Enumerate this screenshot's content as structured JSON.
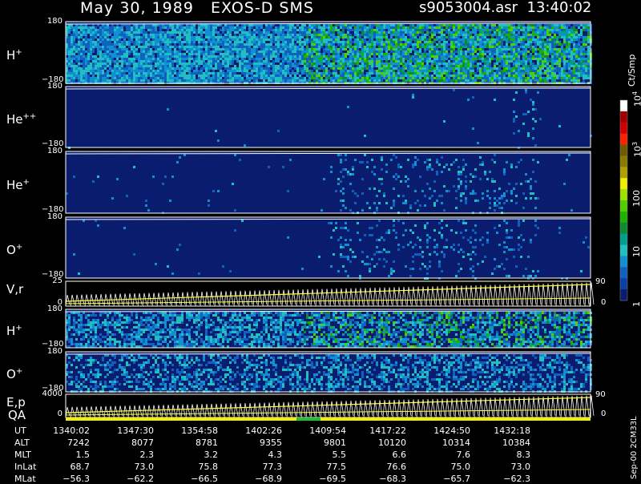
{
  "header": {
    "title": "May 30, 1989   EXOS-D SMS",
    "file_time": "s9053004.asr  13:40:02"
  },
  "colors": {
    "background": "#000000",
    "spectrogram_base": "#0a1c6e",
    "line_yellow": "#ffff40",
    "quality_yellow": "#f0f000",
    "quality_green": "#20c030"
  },
  "panels": [
    {
      "id": "h1",
      "label": "H",
      "sup": "+",
      "tick_top": "180",
      "tick_bottom": "−180"
    },
    {
      "id": "hepp",
      "label": "He",
      "sup": "++",
      "tick_top": "180",
      "tick_bottom": "−180"
    },
    {
      "id": "hep",
      "label": "He",
      "sup": "+",
      "tick_top": "180",
      "tick_bottom": "−180"
    },
    {
      "id": "op",
      "label": "O",
      "sup": "+",
      "tick_top": "180",
      "tick_bottom": "−180"
    },
    {
      "id": "vr",
      "label": "V,r",
      "sup": "",
      "tick_top": "25",
      "tick_bottom": "0",
      "right_top": "90",
      "right_bottom": "0"
    },
    {
      "id": "h2",
      "label": "H",
      "sup": "+",
      "tick_top": "180",
      "tick_bottom": "−180"
    },
    {
      "id": "o2",
      "label": "O",
      "sup": "+",
      "tick_top": "180",
      "tick_bottom": "−180"
    },
    {
      "id": "ep",
      "label": "E,p",
      "sup": "",
      "tick_top": "4000",
      "tick_bottom": "0",
      "right_top": "90",
      "right_bottom": "0"
    }
  ],
  "qa_label": "QA",
  "colorbar": {
    "unit": "Ct/Smp",
    "labels": [
      {
        "text": "10",
        "sup": "4",
        "value": 10000
      },
      {
        "text": "10",
        "sup": "3",
        "value": 1000
      },
      {
        "text": "100",
        "sup": "",
        "value": 100
      },
      {
        "text": "10",
        "sup": "",
        "value": 10
      },
      {
        "text": "1",
        "sup": "",
        "value": 1
      }
    ],
    "colors": [
      "#ffffff",
      "#a00000",
      "#d00000",
      "#ff2000",
      "#6e5a00",
      "#8a7a00",
      "#b0a000",
      "#f0f000",
      "#a0e000",
      "#50d000",
      "#20b000",
      "#108a30",
      "#00a090",
      "#20c0c0",
      "#1090d0",
      "#1060c0",
      "#0a40a0",
      "#0a1c6e"
    ]
  },
  "footer_note": "Sep-00  2CM33L",
  "chart_data": [
    {
      "type": "heatmap",
      "title": "May 30, 1989   EXOS-D SMS",
      "x_label": "UT",
      "x": [
        "1340:02",
        "1347:30",
        "1354:58",
        "1402:26",
        "1409:54",
        "1417:22",
        "1424:50",
        "1432:18"
      ],
      "panels": [
        {
          "name": "H+",
          "ylim": [
            -180,
            180
          ],
          "ytick_labels": [
            "180",
            "−180"
          ]
        },
        {
          "name": "He++",
          "ylim": [
            -180,
            180
          ],
          "ytick_labels": [
            "180",
            "−180"
          ]
        },
        {
          "name": "He+",
          "ylim": [
            -180,
            180
          ],
          "ytick_labels": [
            "180",
            "−180"
          ]
        },
        {
          "name": "O+",
          "ylim": [
            -180,
            180
          ],
          "ytick_labels": [
            "180",
            "−180"
          ]
        },
        {
          "name": "V,r",
          "ylim": [
            0,
            25
          ],
          "y2lim": [
            0,
            90
          ]
        },
        {
          "name": "H+",
          "ylim": [
            -180,
            180
          ],
          "ytick_labels": [
            "180",
            "−180"
          ]
        },
        {
          "name": "O+",
          "ylim": [
            -180,
            180
          ],
          "ytick_labels": [
            "180",
            "−180"
          ]
        },
        {
          "name": "E,p",
          "ylim": [
            0,
            4000
          ],
          "y2lim": [
            0,
            90
          ]
        }
      ],
      "color_scale": {
        "unit": "Ct/Smp",
        "log": true,
        "range": [
          1,
          10000
        ]
      },
      "ephemeris": [
        {
          "name": "UT",
          "values": [
            "1340:02",
            "1347:30",
            "1354:58",
            "1402:26",
            "1409:54",
            "1417:22",
            "1424:50",
            "1432:18"
          ]
        },
        {
          "name": "ALT",
          "values": [
            "7242",
            "8077",
            "8781",
            "9355",
            "9801",
            "10120",
            "10314",
            "10384"
          ]
        },
        {
          "name": "MLT",
          "values": [
            "1.5",
            "2.3",
            "3.2",
            "4.3",
            "5.5",
            "6.6",
            "7.6",
            "8.3"
          ]
        },
        {
          "name": "InLat",
          "values": [
            "68.7",
            "73.0",
            "75.8",
            "77.3",
            "77.5",
            "76.6",
            "75.0",
            "73.0"
          ]
        },
        {
          "name": "MLat",
          "values": [
            "−56.3",
            "−62.2",
            "−66.5",
            "−68.9",
            "−69.5",
            "−68.3",
            "−65.7",
            "−62.3"
          ]
        }
      ]
    }
  ]
}
